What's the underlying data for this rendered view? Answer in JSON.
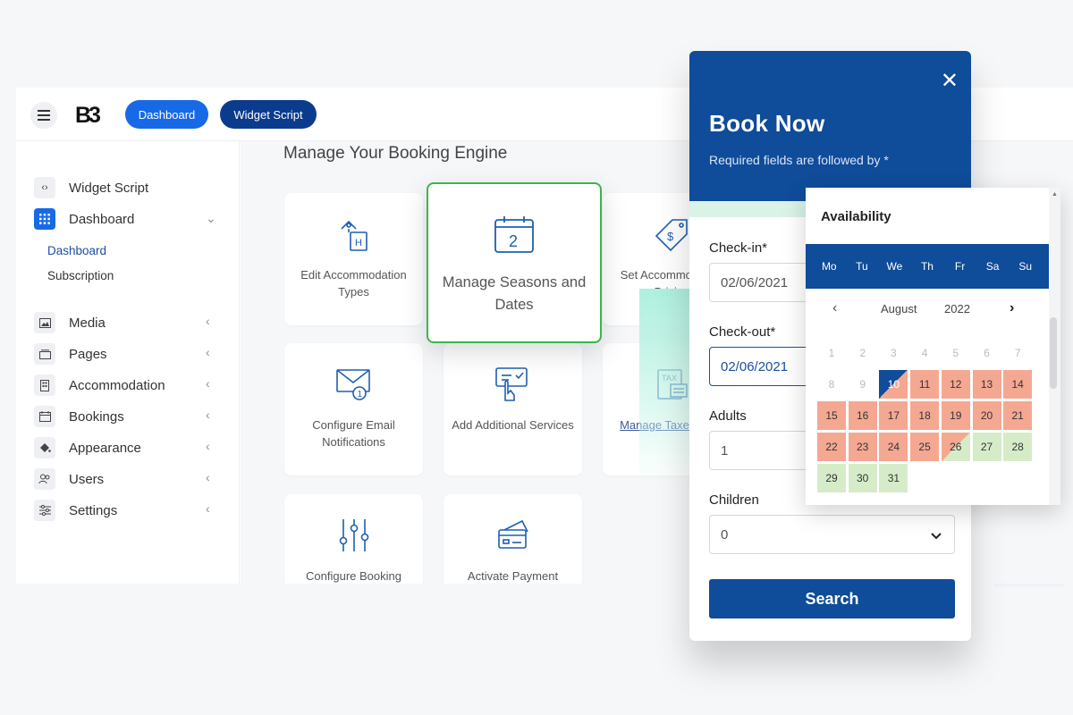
{
  "topbar": {
    "logo_text": "B3",
    "dashboard_label": "Dashboard",
    "widget_label": "Widget Script"
  },
  "sidebar": {
    "items": [
      {
        "label": "Widget Script",
        "icon": "code-icon"
      },
      {
        "label": "Dashboard",
        "icon": "grid-icon"
      },
      {
        "label": "Media",
        "icon": "image-icon"
      },
      {
        "label": "Pages",
        "icon": "pages-icon"
      },
      {
        "label": "Accommodation",
        "icon": "building-icon"
      },
      {
        "label": "Bookings",
        "icon": "calendar-icon"
      },
      {
        "label": "Appearance",
        "icon": "paint-bucket-icon"
      },
      {
        "label": "Users",
        "icon": "users-icon"
      },
      {
        "label": "Settings",
        "icon": "sliders-icon"
      }
    ],
    "sub_items": [
      "Dashboard",
      "Subscription"
    ]
  },
  "main": {
    "title": "Manage Your Booking Engine",
    "cards": [
      {
        "label": "Edit Accommodation Types",
        "icon": "hotel-sign-icon"
      },
      {
        "label": "Manage Seasons and Dates",
        "icon": "calendar-icon"
      },
      {
        "label": "Set Accommodation Pricing",
        "icon": "price-tag-icon"
      },
      {
        "label": "Configure Email Notifications",
        "icon": "envelope-icon"
      },
      {
        "label": "Add Additional Services",
        "icon": "service-click-icon"
      },
      {
        "label": "Manage Taxes Fees",
        "icon": "tax-icon"
      },
      {
        "label": "Configure Booking",
        "icon": "sliders-icon"
      },
      {
        "label": "Activate Payment",
        "icon": "credit-card-icon"
      }
    ]
  },
  "book_now": {
    "title": "Book Now",
    "subtitle": "Required fields are followed by *",
    "close": "✕",
    "checkin_label": "Check-in*",
    "checkin_value": "02/06/2021",
    "checkout_label": "Check-out*",
    "checkout_value": "02/06/2021",
    "adults_label": "Adults",
    "adults_value": "1",
    "children_label": "Children",
    "children_value": "0",
    "search_label": "Search"
  },
  "calendar": {
    "title": "Availability",
    "weekdays": [
      "Mo",
      "Tu",
      "We",
      "Th",
      "Fr",
      "Sa",
      "Su"
    ],
    "month": "August",
    "year": "2022",
    "prev": "‹",
    "next": "›",
    "days": [
      {
        "d": "1",
        "s": "past"
      },
      {
        "d": "2",
        "s": "past"
      },
      {
        "d": "3",
        "s": "past"
      },
      {
        "d": "4",
        "s": "past"
      },
      {
        "d": "5",
        "s": "past"
      },
      {
        "d": "6",
        "s": "past"
      },
      {
        "d": "7",
        "s": "past"
      },
      {
        "d": "8",
        "s": "past"
      },
      {
        "d": "9",
        "s": "past"
      },
      {
        "d": "10",
        "s": "selected"
      },
      {
        "d": "11",
        "s": "booked"
      },
      {
        "d": "12",
        "s": "booked"
      },
      {
        "d": "13",
        "s": "booked"
      },
      {
        "d": "14",
        "s": "booked"
      },
      {
        "d": "15",
        "s": "booked"
      },
      {
        "d": "16",
        "s": "booked"
      },
      {
        "d": "17",
        "s": "booked"
      },
      {
        "d": "18",
        "s": "booked"
      },
      {
        "d": "19",
        "s": "booked"
      },
      {
        "d": "20",
        "s": "booked"
      },
      {
        "d": "21",
        "s": "booked"
      },
      {
        "d": "22",
        "s": "booked"
      },
      {
        "d": "23",
        "s": "booked"
      },
      {
        "d": "24",
        "s": "booked"
      },
      {
        "d": "25",
        "s": "booked"
      },
      {
        "d": "26",
        "s": "half"
      },
      {
        "d": "27",
        "s": "available"
      },
      {
        "d": "28",
        "s": "available"
      },
      {
        "d": "29",
        "s": "available"
      },
      {
        "d": "30",
        "s": "available"
      },
      {
        "d": "31",
        "s": "available"
      }
    ]
  },
  "colors": {
    "primary": "#0f4c99",
    "accent": "#1769e6",
    "booked": "#f4a892",
    "available": "#d6ecc8",
    "highlight_border": "#3cb54a"
  }
}
